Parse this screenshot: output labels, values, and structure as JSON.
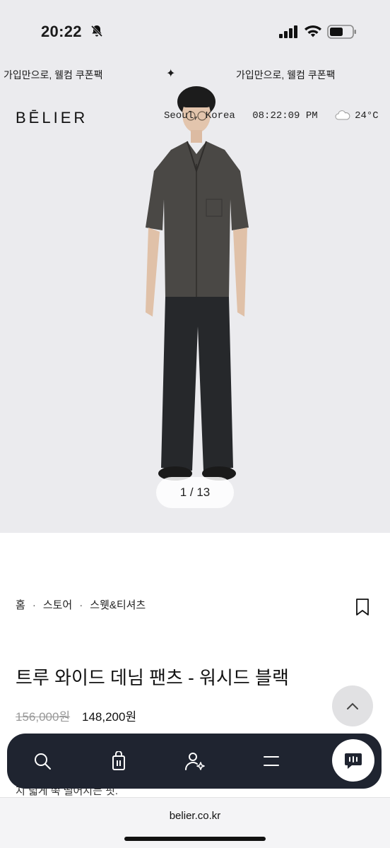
{
  "status_bar": {
    "time": "20:22"
  },
  "promo": {
    "left_text": "가입만으로, 웰컴 쿠폰팩",
    "right_text": "가입만으로, 웰컴 쿠폰팩",
    "star": "✦"
  },
  "header": {
    "logo": "BĒLIER",
    "location": "Seoul, Korea",
    "clock": "08:22:09 PM",
    "temperature": "24°C"
  },
  "hero": {
    "counter": "1 / 13"
  },
  "breadcrumb": {
    "items": [
      "홈",
      "스토어",
      "스웻&티셔츠"
    ],
    "separator": "·"
  },
  "product": {
    "title": "트루 와이드 데님 팬츠 - 워시드 블랙",
    "original_price": "156,000원",
    "sale_price": "148,200원",
    "partial_description": "지 넓게 쭉 떨어지는 핏."
  },
  "url_bar": {
    "url": "belier.co.kr"
  },
  "colors": {
    "nav_bg": "#1f2430",
    "hero_bg": "#ebebee"
  }
}
